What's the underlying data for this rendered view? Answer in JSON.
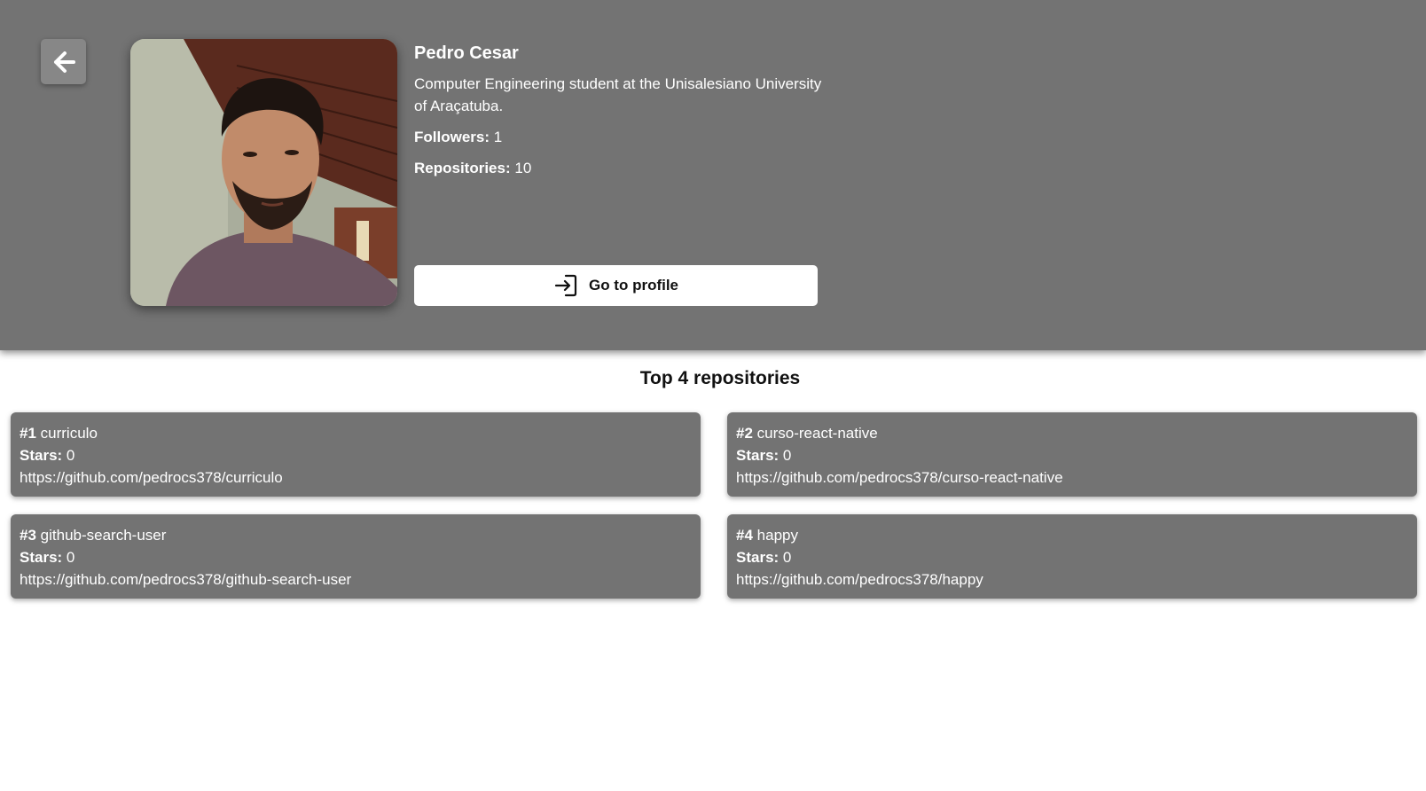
{
  "profile": {
    "name": "Pedro Cesar",
    "bio": "Computer Engineering student at the Unisalesiano University of Araçatuba.",
    "followers_label": "Followers:",
    "followers": "1",
    "repositories_label": "Repositories:",
    "repositories": "10",
    "go_to_profile_label": "Go to profile"
  },
  "icons": {
    "back": "arrow-left-icon",
    "login": "sign-in-icon"
  },
  "repos_section": {
    "title": "Top 4 repositories",
    "stars_label": "Stars:",
    "items": [
      {
        "rank": "#1",
        "name": "curriculo",
        "stars": "0",
        "url": "https://github.com/pedrocs378/curriculo"
      },
      {
        "rank": "#2",
        "name": "curso-react-native",
        "stars": "0",
        "url": "https://github.com/pedrocs378/curso-react-native"
      },
      {
        "rank": "#3",
        "name": "github-search-user",
        "stars": "0",
        "url": "https://github.com/pedrocs378/github-search-user"
      },
      {
        "rank": "#4",
        "name": "happy",
        "stars": "0",
        "url": "https://github.com/pedrocs378/happy"
      }
    ]
  },
  "colors": {
    "header_bg": "#737373",
    "card_bg": "#737373",
    "button_bg": "#ffffff"
  }
}
